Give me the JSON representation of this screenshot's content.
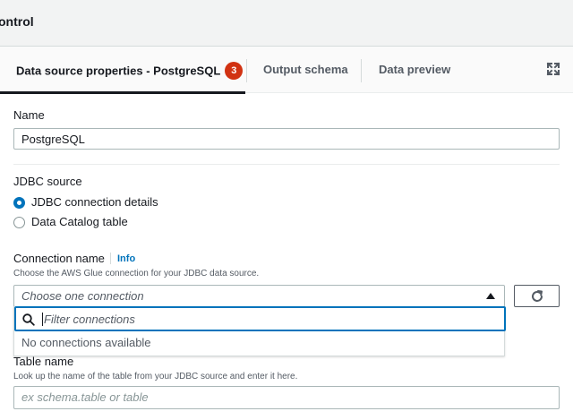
{
  "window": {
    "title": "ontrol"
  },
  "tabs": [
    {
      "label": "Data source properties - PostgreSQL",
      "badge": "3"
    },
    {
      "label": "Output schema"
    },
    {
      "label": "Data preview"
    }
  ],
  "form": {
    "name": {
      "label": "Name",
      "value": "PostgreSQL"
    },
    "jdbc_source": {
      "label": "JDBC source",
      "options": [
        {
          "label": "JDBC connection details",
          "selected": true
        },
        {
          "label": "Data Catalog table",
          "selected": false
        }
      ]
    },
    "connection": {
      "label": "Connection name",
      "info": "Info",
      "description": "Choose the AWS Glue connection for your JDBC data source.",
      "placeholder": "Choose one connection",
      "filter_placeholder": "Filter connections",
      "empty_text": "No connections available"
    },
    "table_name": {
      "label": "Table name",
      "description": "Look up the name of the table from your JDBC source and enter it here.",
      "placeholder": "ex schema.table or table"
    }
  },
  "colors": {
    "accent": "#0073bb",
    "badge": "#d13212",
    "text": "#16191f"
  },
  "icons": [
    "expand-icon",
    "caret-up-icon",
    "refresh-icon",
    "search-icon"
  ]
}
